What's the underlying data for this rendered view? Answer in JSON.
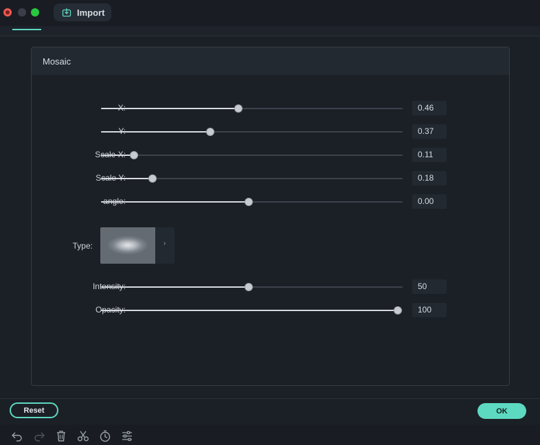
{
  "window": {
    "import_label": "Import"
  },
  "panel": {
    "title": "Mosaic",
    "sliders": [
      {
        "label": "X:",
        "value": "0.46",
        "fraction": 0.455
      },
      {
        "label": "Y:",
        "value": "0.37",
        "fraction": 0.363
      },
      {
        "label": "Scale X:",
        "value": "0.11",
        "fraction": 0.11
      },
      {
        "label": "Scale Y:",
        "value": "0.18",
        "fraction": 0.17
      },
      {
        "label": "angle:",
        "value": "0.00",
        "fraction": 0.49
      }
    ],
    "type": {
      "label": "Type:"
    },
    "sliders2": [
      {
        "label": "Intensity:",
        "value": "50",
        "fraction": 0.49
      },
      {
        "label": "Opacity:",
        "value": "100",
        "fraction": 0.985
      }
    ]
  },
  "footer": {
    "reset_label": "Reset",
    "ok_label": "OK"
  },
  "toolbar": {
    "tools": [
      "undo-icon",
      "redo-icon",
      "delete-icon",
      "cut-icon",
      "timer-icon",
      "adjust-icon"
    ]
  },
  "colors": {
    "accent": "#5ed9c1",
    "background": "#1b2027"
  }
}
